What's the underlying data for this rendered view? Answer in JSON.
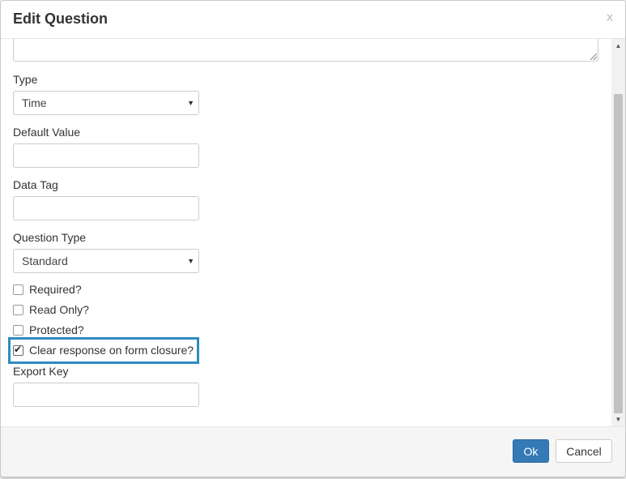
{
  "dialog": {
    "title": "Edit Question",
    "close_label": "x"
  },
  "form": {
    "type": {
      "label": "Type",
      "value": "Time"
    },
    "default_value": {
      "label": "Default Value",
      "value": ""
    },
    "data_tag": {
      "label": "Data Tag",
      "value": ""
    },
    "question_type": {
      "label": "Question Type",
      "value": "Standard"
    },
    "checkboxes": [
      {
        "label": "Required?",
        "checked": false
      },
      {
        "label": "Read Only?",
        "checked": false
      },
      {
        "label": "Protected?",
        "checked": false
      },
      {
        "label": "Clear response on form closure?",
        "checked": true
      }
    ],
    "export_key": {
      "label": "Export Key",
      "value": ""
    }
  },
  "footer": {
    "ok_label": "Ok",
    "cancel_label": "Cancel"
  },
  "colors": {
    "primary": "#337ab7",
    "highlight": "#2e8bc0"
  }
}
